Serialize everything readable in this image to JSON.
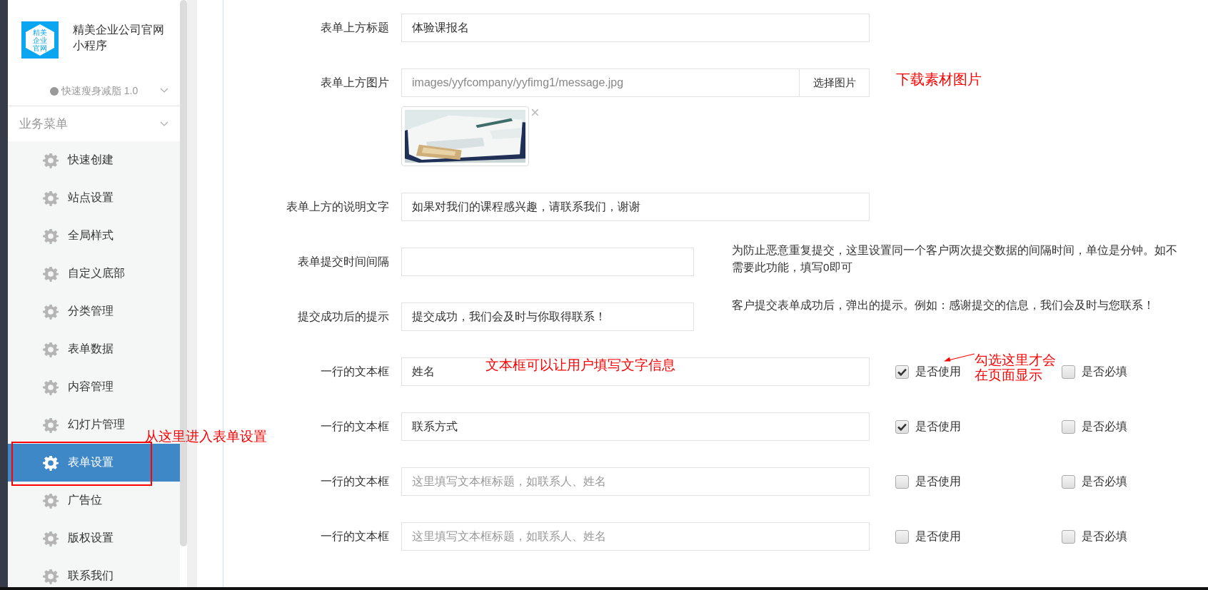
{
  "sidebar": {
    "logo_lines": [
      "精美",
      "企业",
      "官网"
    ],
    "app_name": "精美企业公司官网小程序",
    "version": "快速瘦身减脂 1.0",
    "section": "业务菜单",
    "items": [
      {
        "label": "快速创建",
        "selected": false
      },
      {
        "label": "站点设置",
        "selected": false
      },
      {
        "label": "全局样式",
        "selected": false
      },
      {
        "label": "自定义底部",
        "selected": false
      },
      {
        "label": "分类管理",
        "selected": false
      },
      {
        "label": "表单数据",
        "selected": false
      },
      {
        "label": "内容管理",
        "selected": false
      },
      {
        "label": "幻灯片管理",
        "selected": false
      },
      {
        "label": "表单设置",
        "selected": true,
        "framed": true,
        "annotation": "从这里进入表单设置"
      },
      {
        "label": "广告位",
        "selected": false
      },
      {
        "label": "版权设置",
        "selected": false
      },
      {
        "label": "联系我们",
        "selected": false
      }
    ]
  },
  "form": {
    "rows": [
      {
        "kind": "text",
        "label": "表单上方标题",
        "value": "体验课报名"
      },
      {
        "label": "表单上方图片",
        "value": "images/yyfcompany/yyfimg1/message.jpg",
        "button": "选择图片",
        "remove": "×",
        "annotation": "下载素材图片"
      },
      {
        "kind": "text",
        "label": "表单上方的说明文字",
        "value": "如果对我们的课程感兴趣，请联系我们，谢谢"
      },
      {
        "kind": "hint",
        "label": "表单提交时间间隔",
        "value": "",
        "hint": "为防止恶意重复提交，这里设置同一个客户两次提交数据的间隔时间，单位是分钟。如不需要此功能，填写0即可"
      },
      {
        "kind": "hint",
        "label": "提交成功后的提示",
        "value": "提交成功，我们会及时与你取得联系！",
        "hint": "客户提交表单成功后，弹出的提示。例如：感谢提交的信息，我们会及时与您联系！"
      },
      {
        "kind": "field",
        "label": "一行的文本框",
        "value": "姓名",
        "annotation": "文本框可以让用户填写文字信息",
        "use": {
          "label": "是否使用",
          "checked": true,
          "annotation": "勾选这里才会在页面显示"
        },
        "required": {
          "label": "是否必填",
          "checked": false
        }
      },
      {
        "kind": "field",
        "label": "一行的文本框",
        "value": "联系方式",
        "use": {
          "label": "是否使用",
          "checked": true
        },
        "required": {
          "label": "是否必填",
          "checked": false
        }
      },
      {
        "kind": "field",
        "label": "一行的文本框",
        "placeholder": "这里填写文本框标题，如联系人、姓名",
        "use": {
          "label": "是否使用",
          "checked": false
        },
        "required": {
          "label": "是否必填",
          "checked": false
        }
      },
      {
        "kind": "field",
        "label": "一行的文本框",
        "placeholder": "这里填写文本框标题，如联系人、姓名",
        "use": {
          "label": "是否使用",
          "checked": false
        },
        "required": {
          "label": "是否必填",
          "checked": false
        }
      }
    ]
  }
}
